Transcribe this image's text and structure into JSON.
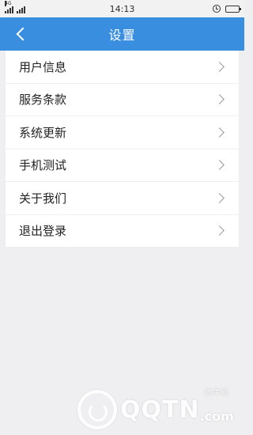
{
  "status_bar": {
    "network": "4G",
    "time": "14:13",
    "battery_level": 0.7
  },
  "header": {
    "title": "设置"
  },
  "menu": {
    "items": [
      {
        "label": "用户信息"
      },
      {
        "label": "服务条款"
      },
      {
        "label": "系统更新"
      },
      {
        "label": "手机测试"
      },
      {
        "label": "关于我们"
      },
      {
        "label": "退出登录"
      }
    ]
  },
  "colors": {
    "header_bg": "#3a8ee0",
    "page_bg": "#efeff1"
  },
  "watermark": {
    "brand": "QQTN",
    "domain_suffix": ".com",
    "site_name": "腾牛网"
  }
}
